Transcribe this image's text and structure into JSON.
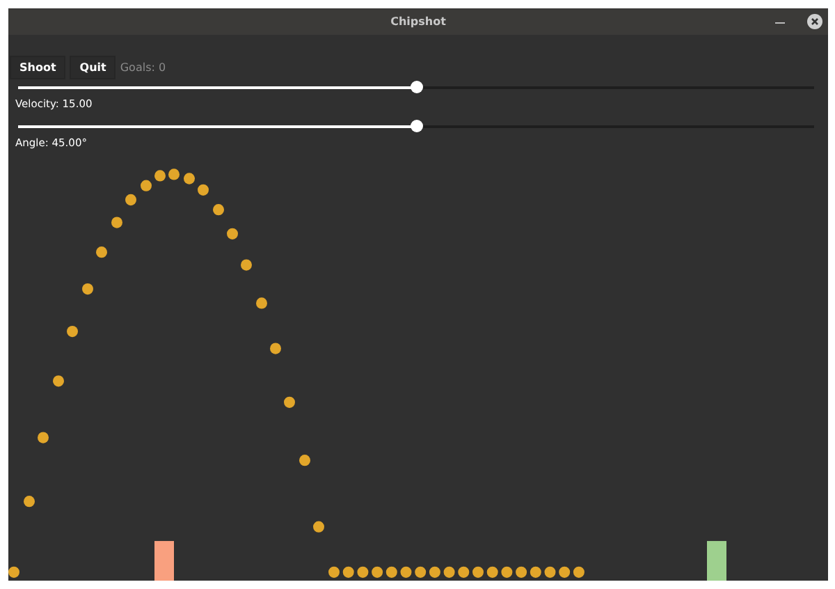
{
  "window": {
    "title": "Chipshot"
  },
  "buttons": [
    {
      "label": "Shoot"
    },
    {
      "label": "Quit"
    }
  ],
  "goals_label": "Goals: 0",
  "sliders": [
    {
      "level": 0.5,
      "label": "Velocity: 15.00"
    },
    {
      "level": 0.5,
      "label": "Angle: 45.00°"
    }
  ],
  "goals": [
    {
      "color": "#f9a07f"
    },
    {
      "color": "#9ed08e"
    }
  ]
}
